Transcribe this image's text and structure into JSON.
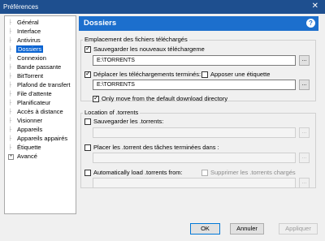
{
  "window": {
    "title": "Préférences",
    "close_glyph": "✕"
  },
  "tree": {
    "items": [
      {
        "label": "Général"
      },
      {
        "label": "Interface"
      },
      {
        "label": "Antivirus"
      },
      {
        "label": "Dossiers",
        "selected": true
      },
      {
        "label": "Connexion"
      },
      {
        "label": "Bande passante"
      },
      {
        "label": "BitTorrent"
      },
      {
        "label": "Plafond de transfert"
      },
      {
        "label": "File d'attente"
      },
      {
        "label": "Planificateur"
      },
      {
        "label": "Accès à distance"
      },
      {
        "label": "Visionner"
      },
      {
        "label": "Appareils"
      },
      {
        "label": "Appareils appairés"
      },
      {
        "label": "Étiquette"
      },
      {
        "label": "Avancé",
        "expandable": true
      }
    ]
  },
  "header": {
    "title": "Dossiers",
    "help_glyph": "?"
  },
  "download_group": {
    "legend": "Emplacement des fichiers téléchargés",
    "save_new_label": "Sauvegarder les nouveaux téléchargeme",
    "save_new_checked": true,
    "save_path": "E:\\TORRENTS",
    "move_completed_label": "Déplacer les téléchargements terminés:",
    "move_completed_checked": true,
    "apply_label_label": "Apposer une étiquette",
    "apply_label_checked": false,
    "move_path": "E:\\TORRENTS",
    "only_move_label": "Only move from the default download directory",
    "only_move_checked": true,
    "browse_glyph": "..."
  },
  "torrents_group": {
    "legend": "Location of .torrents",
    "save_torrents_label": "Sauvegarder les .torrents:",
    "save_torrents_checked": false,
    "completed_torrents_label": "Placer les .torrent des tâches terminées dans :",
    "completed_torrents_checked": false,
    "auto_load_label": "Automatically load .torrents from:",
    "auto_load_checked": false,
    "delete_loaded_label": "Supprimer les .torrents chargés",
    "delete_loaded_checked": false,
    "browse_glyph": "..."
  },
  "buttons": {
    "ok": "OK",
    "cancel": "Annuler",
    "apply": "Appliquer"
  }
}
